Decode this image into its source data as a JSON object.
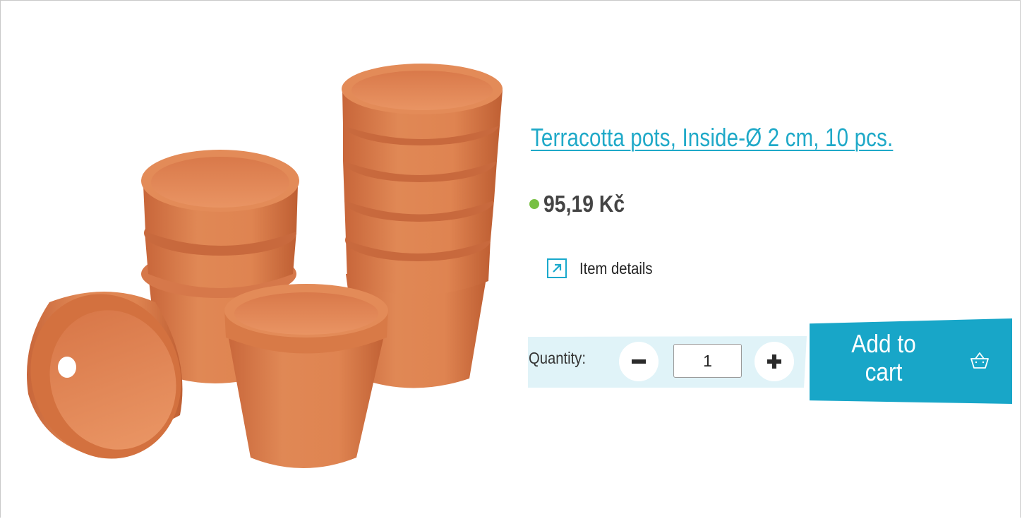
{
  "product": {
    "title": "Terracotta pots, Inside-Ø 2 cm, 10 pcs.",
    "price": "95,19 Kč",
    "availability_color": "#78c043",
    "details_link": "Item details",
    "image_icon": "terracotta-pots-image"
  },
  "cart": {
    "quantity_label": "Quantity:",
    "quantity_value": "1",
    "add_to_cart_line1": "Add to",
    "add_to_cart_line2": "cart",
    "minus_icon": "minus-icon",
    "plus_icon": "plus-icon",
    "basket_icon": "basket-icon"
  },
  "colors": {
    "accent": "#18a6c8",
    "quantity_background": "#e0f3f8",
    "price_text": "#444444"
  }
}
